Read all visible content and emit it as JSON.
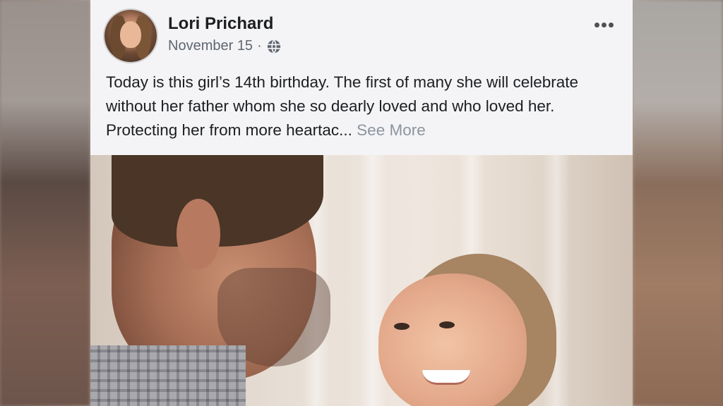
{
  "post": {
    "author_name": "Lori Prichard",
    "date": "November 15",
    "separator": "·",
    "privacy_icon": "globe-icon",
    "options_icon": "more-options-icon",
    "body_text": "Today is this girl’s 14th birthday. The first of many she will celebrate without her father whom she so dearly loved and who loved her. Protecting her from more heartac...",
    "see_more_label": "See More"
  },
  "colors": {
    "card_background": "#f4f4f6",
    "name_color": "#1c1e21",
    "meta_color": "#606770",
    "see_more_color": "#8d949e"
  }
}
